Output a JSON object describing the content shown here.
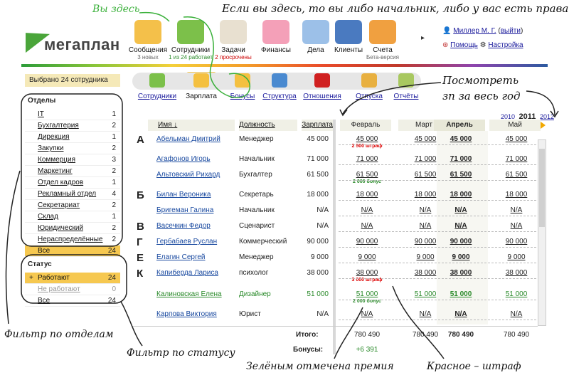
{
  "annotations": {
    "you_are_here": "Вы здесь",
    "top_note": "Если вы здесь, то вы либо начальник, либо у вас есть права :-)",
    "see_salary": "Посмотреть",
    "see_salary_2": "зп за весь год",
    "filter_depts": "Фильтр по отделам",
    "filter_status": "Фильтр по статусу",
    "green_note": "Зелёным отмечена премия",
    "red_note": "Красное – штраф"
  },
  "brand": {
    "logo_text": "мегаплан",
    "accent": "#4aa53a"
  },
  "modules": [
    {
      "label": "Сообщения",
      "sub": "3 новых",
      "icon": "envelope-icon",
      "color": "#f4c04a"
    },
    {
      "label": "Сотрудники",
      "sub": "1 из 24 работает",
      "icon": "people-icon",
      "color": "#7cc04a"
    },
    {
      "label": "Задачи",
      "sub": "2 просрочены",
      "icon": "tasks-icon",
      "color": "#e8e0d0"
    },
    {
      "label": "Финансы",
      "sub": "",
      "icon": "piggy-bank-icon",
      "color": "#f4a0b8"
    },
    {
      "label": "Дела",
      "sub": "",
      "icon": "clock-icon",
      "color": "#9cc0e8"
    },
    {
      "label": "Клиенты",
      "sub": "",
      "icon": "target-icon",
      "color": "#4a7ac0"
    },
    {
      "label": "Счета",
      "sub": "Бета-версия",
      "icon": "invoice-icon",
      "color": "#f0a040"
    }
  ],
  "more_arrow": "▸",
  "user": {
    "name": "Миллер М. Г.",
    "logout": "выйти",
    "help": "Помощь",
    "settings": "Настройка"
  },
  "selected_count": "Выбрано 24 сотрудника",
  "departments_title": "Отделы",
  "departments": [
    {
      "name": "IT",
      "count": "1"
    },
    {
      "name": "Бухгалтерия",
      "count": "2"
    },
    {
      "name": "Дирекция",
      "count": "1"
    },
    {
      "name": "Закупки",
      "count": "2"
    },
    {
      "name": "Коммерция",
      "count": "3"
    },
    {
      "name": "Маркетинг",
      "count": "2"
    },
    {
      "name": "Отдел кадров",
      "count": "1"
    },
    {
      "name": "Рекламный отдел",
      "count": "4"
    },
    {
      "name": "Секретариат",
      "count": "2"
    },
    {
      "name": "Склад",
      "count": "1"
    },
    {
      "name": "Юридический",
      "count": "2"
    },
    {
      "name": "Нераспределённые",
      "count": "2"
    },
    {
      "name": "Все",
      "count": "24"
    }
  ],
  "status_title": "Статус",
  "statuses": [
    {
      "name": "Работают",
      "count": "24",
      "plus": "+"
    },
    {
      "name": "Не работают",
      "count": "0",
      "plus": ""
    },
    {
      "name": "Все",
      "count": "24",
      "plus": ""
    }
  ],
  "tabs": [
    {
      "label": "Сотрудники",
      "icon": "employees-icon",
      "color": "#7cc04a"
    },
    {
      "label": "Зарплата",
      "icon": "coin-icon",
      "color": "#f4c040"
    },
    {
      "label": "Бонусы",
      "icon": "thumbs-up-icon",
      "color": "#f4c040"
    },
    {
      "label": "Структура",
      "icon": "structure-icon",
      "color": "#4a8ad0"
    },
    {
      "label": "Отношения",
      "icon": "heart-icon",
      "color": "#d02020"
    },
    {
      "label": "Отпуска",
      "icon": "vacation-icon",
      "color": "#e8b040"
    },
    {
      "label": "Отчёты",
      "icon": "report-icon",
      "color": "#a8c860"
    }
  ],
  "years": {
    "prev": "2010",
    "current": "2011",
    "next": "2012"
  },
  "columns": {
    "name": "Имя",
    "sort": "↓",
    "position": "Должность",
    "salary": "Зарплата"
  },
  "months": [
    "Февраль",
    "Март",
    "Апрель",
    "Май"
  ],
  "rows": [
    {
      "letter": "А",
      "name": "Абельман Дмитрий",
      "position": "Менеджер",
      "salary": "45 000",
      "m": [
        "45 000",
        "45 000",
        "45 000",
        "45 000"
      ],
      "note": "2 500 штраф",
      "note_type": "red"
    },
    {
      "letter": "",
      "name": "Агафонов Игорь",
      "position": "Начальник",
      "salary": "71 000",
      "m": [
        "71 000",
        "71 000",
        "71 000",
        "71 000"
      ],
      "note": "",
      "note_type": ""
    },
    {
      "letter": "",
      "name": "Альтовский Рихард",
      "position": "Бухгалтер",
      "salary": "61 500",
      "m": [
        "61 500",
        "61 500",
        "61 500",
        "61 500"
      ],
      "note": "2 000 бонус",
      "note_type": "grn"
    },
    {
      "letter": "Б",
      "name": "Билан Вероника",
      "position": "Секретарь",
      "salary": "18 000",
      "m": [
        "18 000",
        "18 000",
        "18 000",
        "18 000"
      ],
      "note": "",
      "note_type": ""
    },
    {
      "letter": "",
      "name": "Бригеман Галина",
      "position": "Начальник",
      "salary": "N/A",
      "m": [
        "N/A",
        "N/A",
        "N/A",
        "N/A"
      ],
      "note": "",
      "note_type": ""
    },
    {
      "letter": "В",
      "name": "Васечкин Федор",
      "position": "Сценарист",
      "salary": "N/A",
      "m": [
        "N/A",
        "N/A",
        "N/A",
        "N/A"
      ],
      "note": "",
      "note_type": ""
    },
    {
      "letter": "Г",
      "name": "Гербабаев Руслан",
      "position": "Коммерческий",
      "salary": "90 000",
      "m": [
        "90 000",
        "90 000",
        "90 000",
        "90 000"
      ],
      "note": "",
      "note_type": ""
    },
    {
      "letter": "Е",
      "name": "Елагин Сергей",
      "position": "Менеджер",
      "salary": "9 000",
      "m": [
        "9 000",
        "9 000",
        "9 000",
        "9 000"
      ],
      "note": "",
      "note_type": ""
    },
    {
      "letter": "К",
      "name": "Капиберда Лариса",
      "position": "психолог",
      "salary": "38 000",
      "m": [
        "38 000",
        "38 000",
        "38 000",
        "38 000"
      ],
      "note": "3 000 штраф",
      "note_type": "red"
    },
    {
      "letter": "",
      "name": "Калиновская Елена",
      "position": "Дизайнер",
      "salary": "51 000",
      "m": [
        "51 000",
        "51 000",
        "51 000",
        "51 000"
      ],
      "note": "2 000 бонус",
      "note_type": "grn",
      "green": true
    },
    {
      "letter": "",
      "name": "Карпова Виктория",
      "position": "Юрист",
      "salary": "N/A",
      "m": [
        "N/A",
        "N/A",
        "N/A",
        "N/A"
      ],
      "note": "",
      "note_type": ""
    }
  ],
  "totals": {
    "label": "Итого:",
    "values": [
      "780 490",
      "780 490",
      "780 490",
      "780 490"
    ],
    "bonus_label": "Бонусы:",
    "bonus": "+6 391"
  }
}
